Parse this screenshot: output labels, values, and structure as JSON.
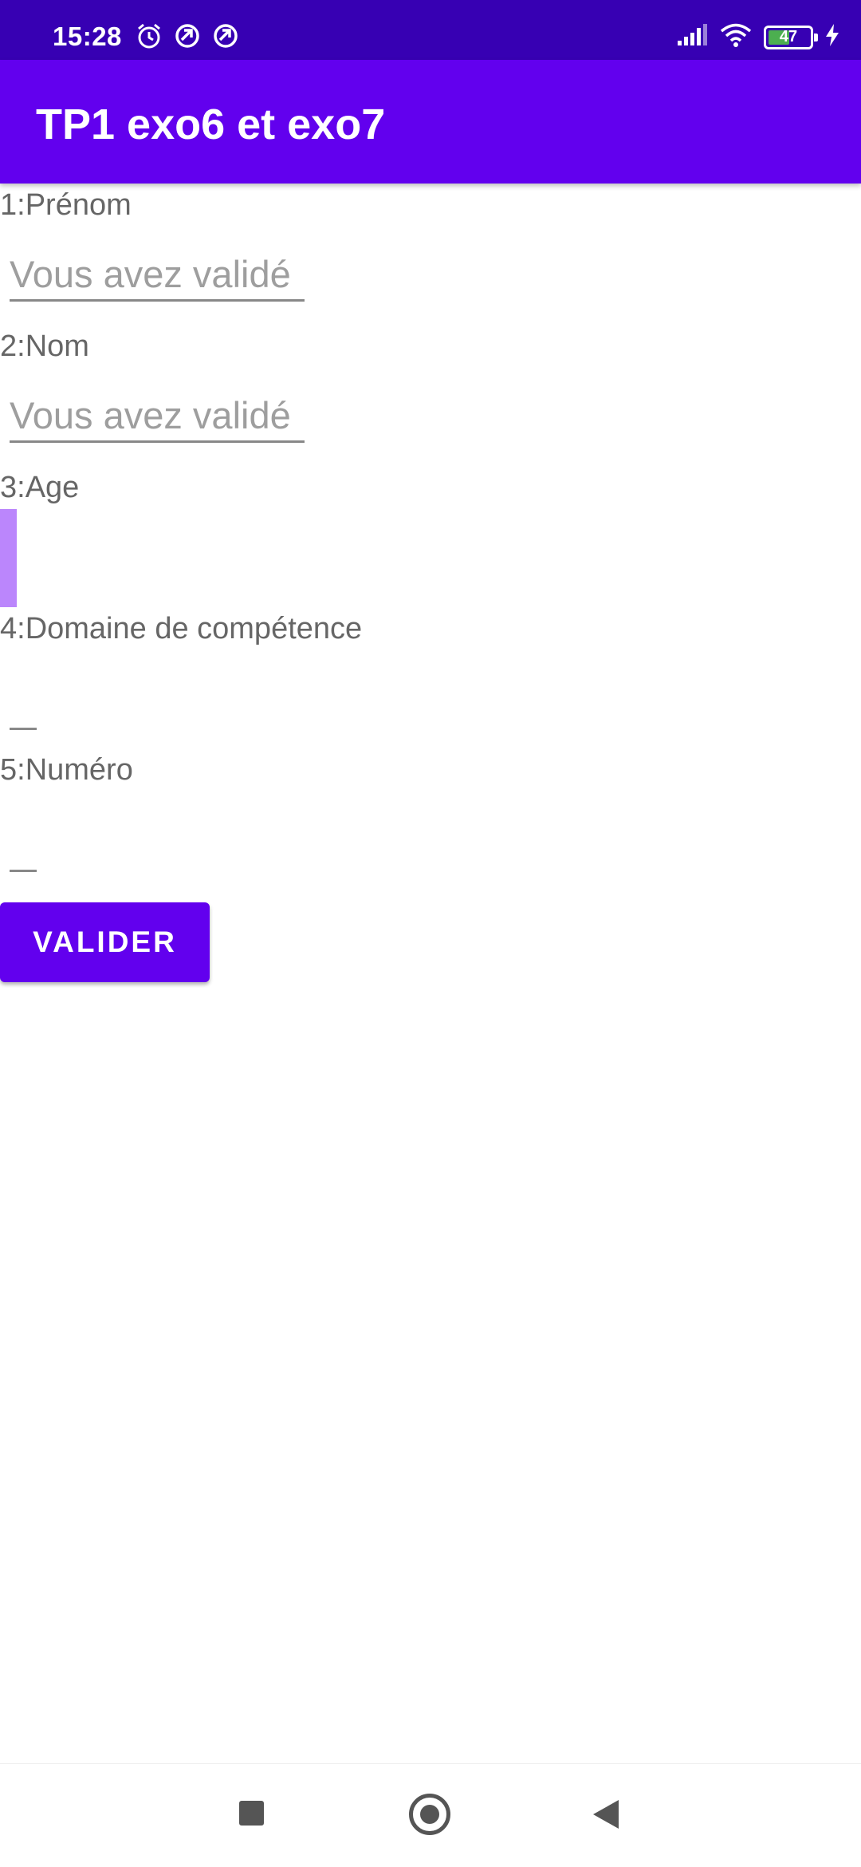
{
  "status_bar": {
    "time": "15:28",
    "battery_level": "47",
    "icons_left": [
      "alarm-icon",
      "sync-icon",
      "sync-icon"
    ],
    "icons_right": [
      "signal-icon",
      "wifi-icon",
      "battery-icon",
      "charging-icon"
    ]
  },
  "app_bar": {
    "title": "TP1 exo6 et exo7",
    "color": "#6200EE"
  },
  "form": {
    "fields": [
      {
        "label": "1:Prénom",
        "hint": "Vous avez validé"
      },
      {
        "label": "2:Nom",
        "hint": "Vous avez validé"
      },
      {
        "label": "3:Age"
      },
      {
        "label": "4:Domaine de compétence"
      },
      {
        "label": "5:Numéro"
      }
    ],
    "submit_label": "VALIDER"
  },
  "colors": {
    "status_bar": "#3700B3",
    "primary": "#6200EE",
    "accent_light": "#BB86FC"
  },
  "navigation": {
    "buttons": [
      "recent-apps-icon",
      "home-icon",
      "back-icon"
    ]
  }
}
